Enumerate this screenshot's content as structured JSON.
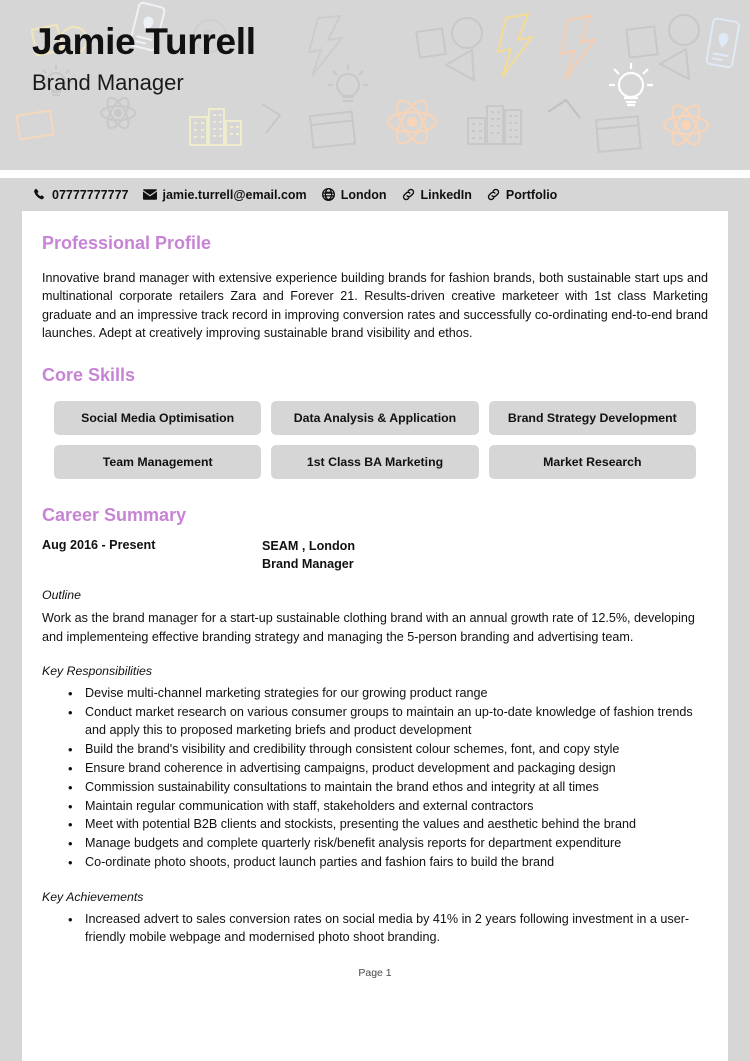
{
  "header": {
    "name": "Jamie Turrell",
    "job_title": "Brand Manager",
    "background_color": "#d6d6d6",
    "icons": [
      "mobile-pin-icon",
      "lightning-bolt-icon",
      "lightbulb-icon",
      "atom-icon",
      "buildings-icon",
      "window-icon",
      "shapes-icon",
      "circle-icon",
      "triangle-icon",
      "square-icon",
      "chevron-icon"
    ]
  },
  "contact": {
    "accent_color": "#c784d4",
    "items": [
      {
        "icon": "phone-icon",
        "label": "07777777777"
      },
      {
        "icon": "envelope-icon",
        "label": "jamie.turrell@email.com"
      },
      {
        "icon": "globe-icon",
        "label": "London"
      },
      {
        "icon": "link-icon",
        "label": "LinkedIn"
      },
      {
        "icon": "link-icon",
        "label": "Portfolio"
      }
    ]
  },
  "sections": {
    "profile": {
      "title": "Professional Profile",
      "text": "Innovative brand manager with extensive experience building brands for fashion brands, both sustainable start ups and multinational corporate retailers Zara and Forever 21. Results-driven creative marketeer with 1st class Marketing graduate and an impressive track record in improving conversion rates and successfully co-ordinating end-to-end brand launches. Adept at creatively improving sustainable brand visibility and ethos."
    },
    "skills": {
      "title": "Core Skills",
      "items": [
        "Social Media Optimisation",
        "Data Analysis & Application",
        "Brand Strategy Development",
        "Team Management",
        "1st Class BA Marketing",
        "Market Research"
      ]
    },
    "career": {
      "title": "Career Summary",
      "jobs": [
        {
          "dates": "Aug 2016 - Present",
          "company": "SEAM , London",
          "role": "Brand Manager",
          "outline_label": "Outline",
          "outline": "Work as the brand manager for a start-up sustainable clothing brand with an annual growth rate of 12.5%, developing and implementeing effective branding strategy and managing the 5-person branding and advertising team.",
          "responsibilities_label": "Key Responsibilities",
          "responsibilities": [
            "Devise multi-channel marketing strategies for our growing product range",
            "Conduct market research on various consumer groups to maintain an up-to-date knowledge of fashion trends and apply this to proposed marketing briefs and product development",
            "Build the brand's visibility and credibility through consistent colour schemes, font, and copy style",
            "Ensure brand coherence in advertising campaigns, product development and packaging design",
            "Commission sustainability consultations to maintain the brand ethos and integrity at all times",
            "Maintain regular communication with staff, stakeholders and external contractors",
            "Meet with potential B2B clients and stockists, presenting the values and aesthetic behind the brand",
            "Manage budgets and complete quarterly risk/benefit analysis reports for department expenditure",
            "Co-ordinate photo shoots, product launch parties and fashion fairs to build the brand"
          ],
          "achievements_label": "Key Achievements",
          "achievements": [
            "Increased advert to sales conversion rates on social media by 41% in 2 years following investment in a user-friendly mobile webpage and modernised photo shoot branding."
          ]
        }
      ]
    }
  },
  "footer": {
    "page_label": "Page 1"
  }
}
